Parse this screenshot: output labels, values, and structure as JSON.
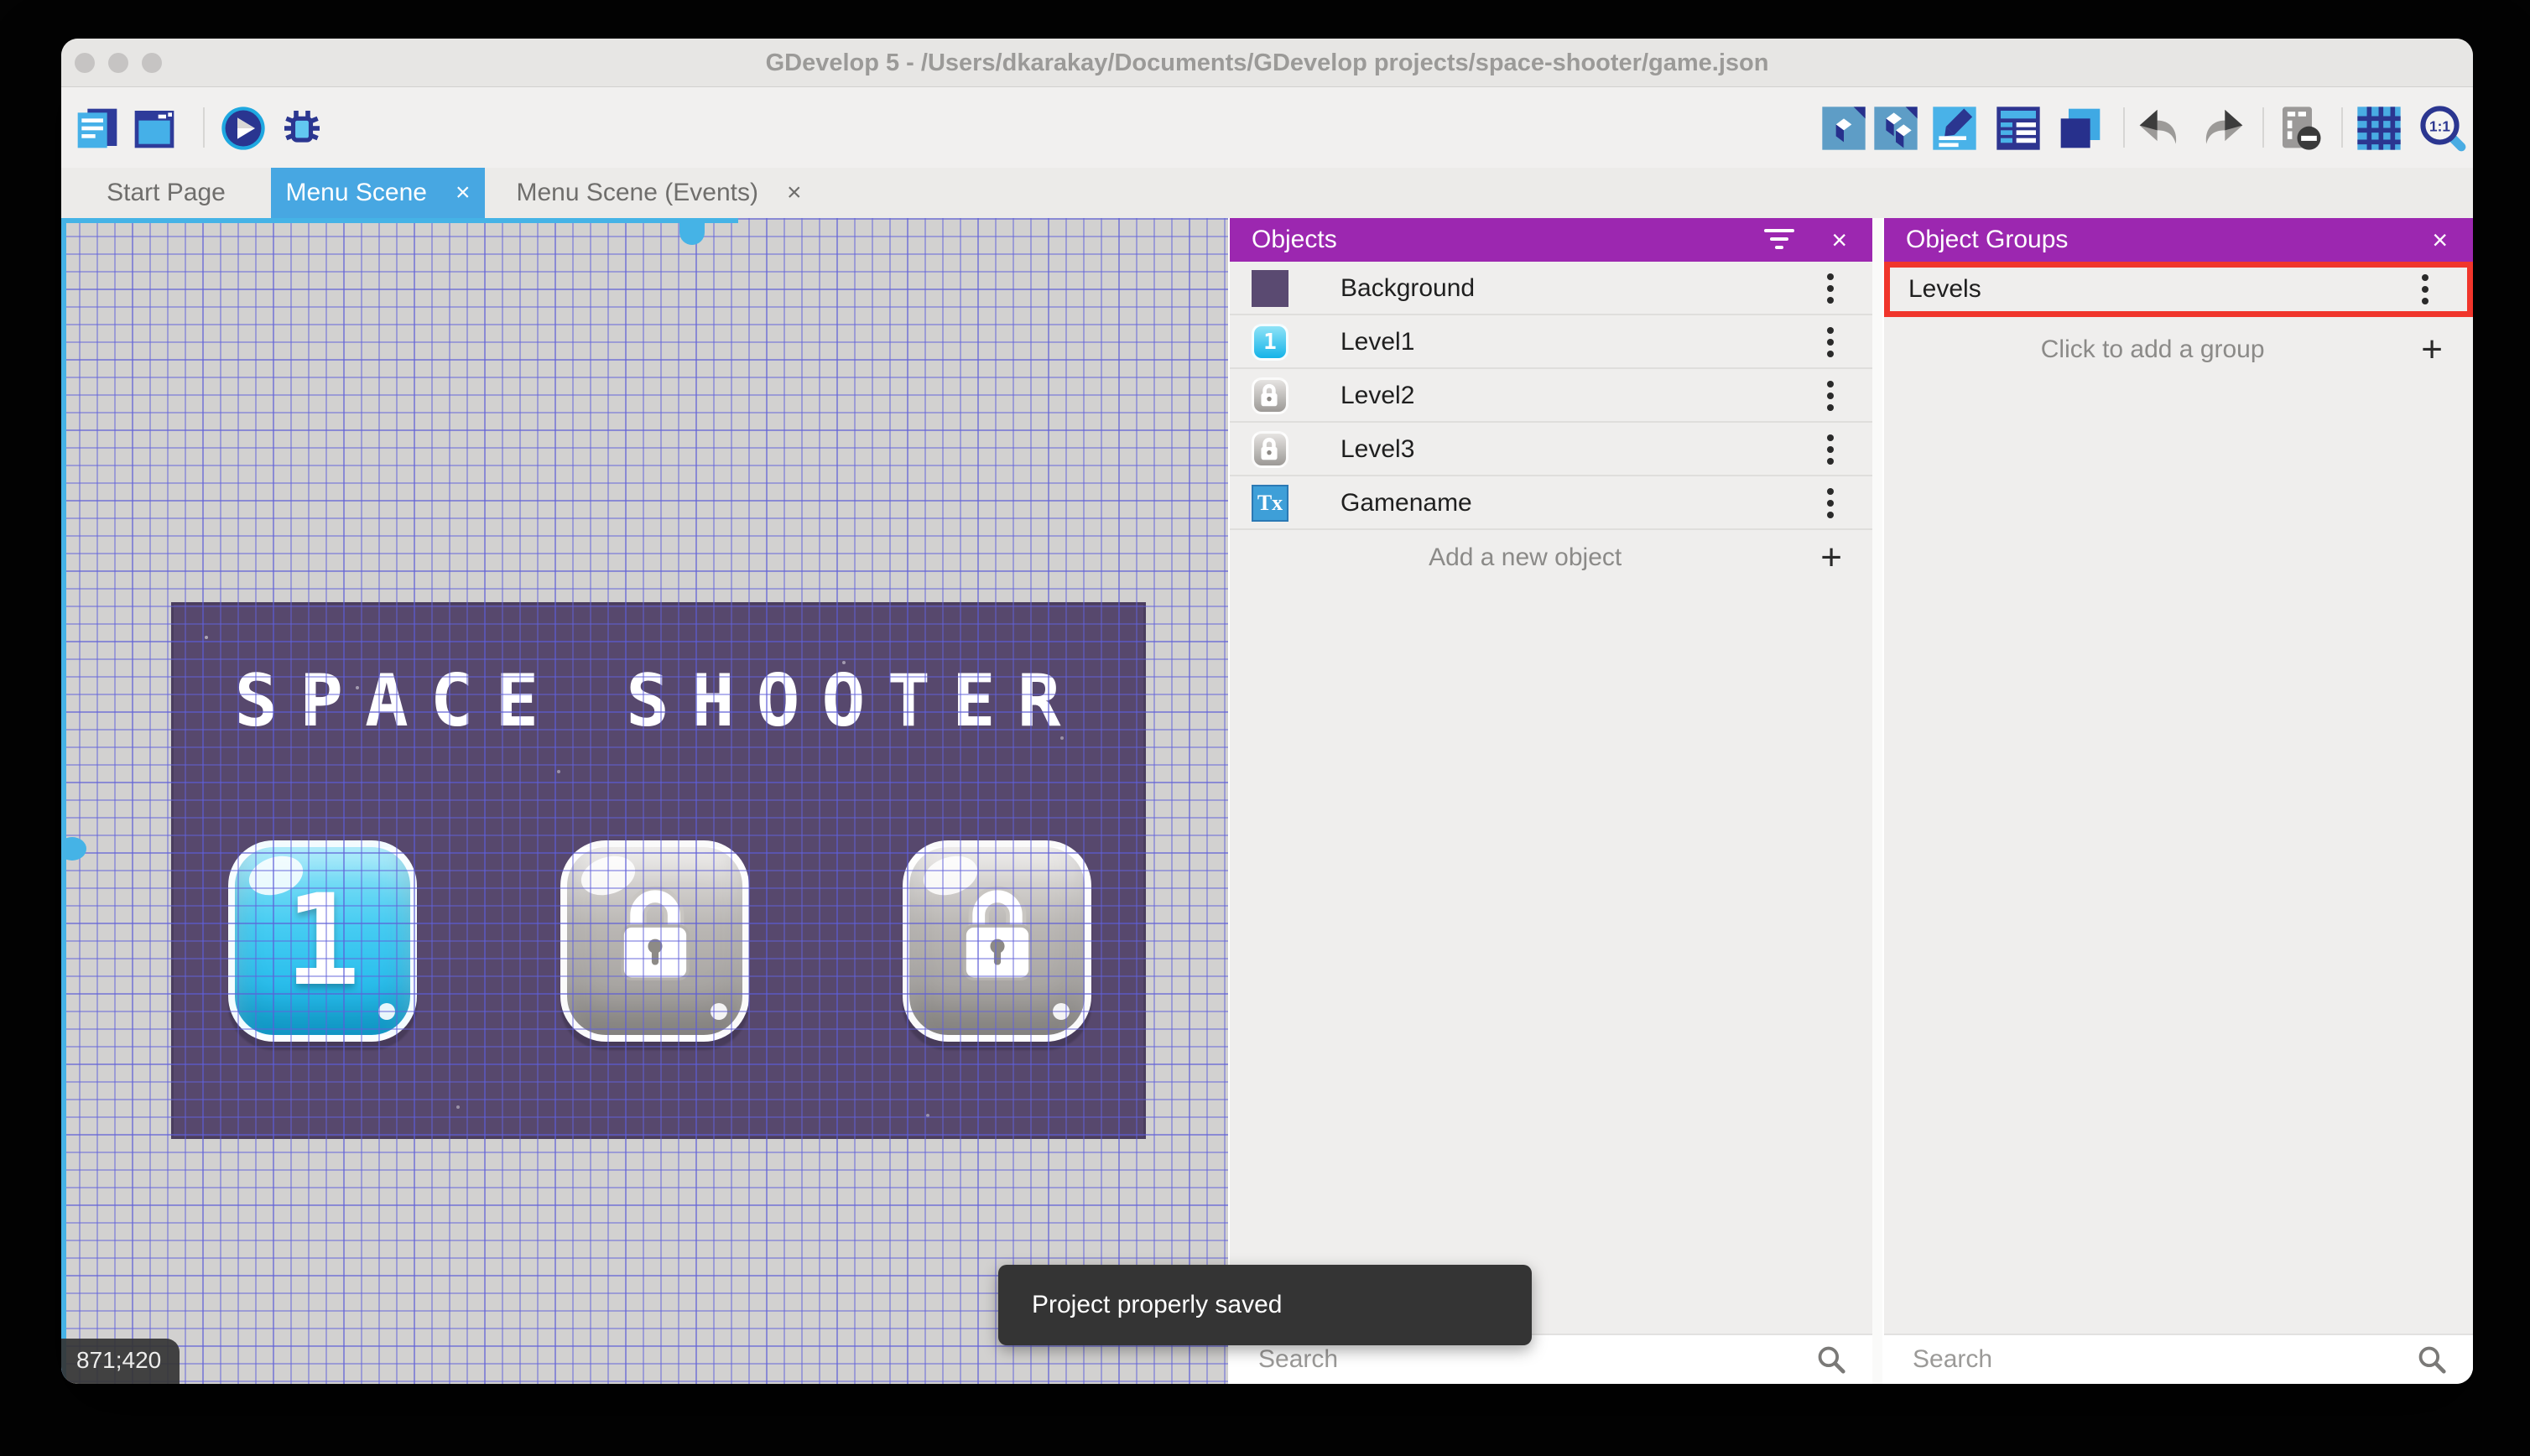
{
  "window": {
    "title": "GDevelop 5 - /Users/dkarakay/Documents/GDevelop projects/space-shooter/game.json"
  },
  "icons": {
    "close": "×",
    "plus": "+"
  },
  "toolbar": {
    "zoom_label": "1:1"
  },
  "tabs": [
    {
      "label": "Start Page"
    },
    {
      "label": "Menu Scene"
    },
    {
      "label": "Menu Scene (Events)"
    }
  ],
  "canvas": {
    "coordinates": "871;420",
    "scene": {
      "title": "SPACE SHOOTER",
      "level_buttons": [
        {
          "state": "unlocked",
          "label": "1"
        },
        {
          "state": "locked"
        },
        {
          "state": "locked"
        }
      ]
    }
  },
  "objects_panel": {
    "title": "Objects",
    "items": [
      {
        "name": "Background",
        "thumb": "background-swatch"
      },
      {
        "name": "Level1",
        "thumb": "level-button-unlocked",
        "thumb_label": "1"
      },
      {
        "name": "Level2",
        "thumb": "level-button-locked"
      },
      {
        "name": "Level3",
        "thumb": "level-button-locked"
      },
      {
        "name": "Gamename",
        "thumb": "text-object",
        "thumb_label": "Tx"
      }
    ],
    "add_label": "Add a new object",
    "search_placeholder": "Search"
  },
  "groups_panel": {
    "title": "Object Groups",
    "groups": [
      {
        "name": "Levels",
        "highlighted": true
      }
    ],
    "add_label": "Click to add a group",
    "search_placeholder": "Search"
  },
  "toast": {
    "message": "Project properly saved"
  },
  "colors": {
    "accent_purple": "#9C27B0",
    "active_tab_blue": "#47A7E2",
    "highlight_red": "#F0352B",
    "scene_background": "#57486D",
    "viewport_border_cyan": "#45B3E6",
    "toast_background": "#343434"
  }
}
